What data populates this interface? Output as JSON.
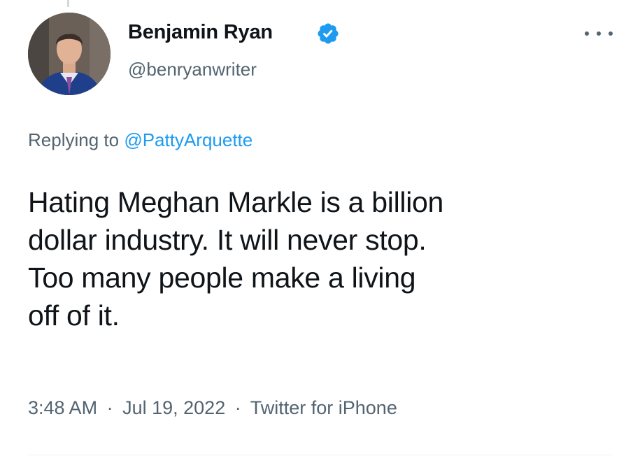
{
  "tweet": {
    "author": {
      "display_name": "Benjamin Ryan",
      "handle": "@benryanwriter",
      "verified": true,
      "avatar_icon": "profile-photo"
    },
    "reply": {
      "prefix": "Replying to",
      "mention": "@PattyArquette"
    },
    "text_lines": [
      "Hating Meghan Markle is a billion",
      "dollar industry. It will never stop.",
      "Too many people make a living",
      "off of it."
    ],
    "time": "3:48 AM",
    "date": "Jul 19, 2022",
    "source": "Twitter for iPhone",
    "separator": "·"
  },
  "colors": {
    "text": "#0f1419",
    "secondary": "#536471",
    "accent": "#1d9bf0"
  }
}
